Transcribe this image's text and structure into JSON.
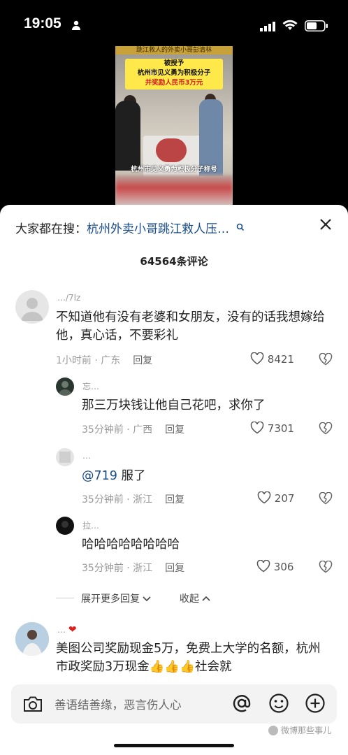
{
  "status_bar": {
    "time": "19:05"
  },
  "video": {
    "top_banner": "跳江救人的外卖小哥彭清林",
    "notice_line1": "被授予",
    "notice_line2": "杭州市见义勇为积极分子",
    "notice_line3": "并奖励人民币3万元",
    "caption": "杭州市见义勇为积极分子称号"
  },
  "search": {
    "prefix": "大家都在搜：",
    "query": "杭州外卖小哥跳江救人压…"
  },
  "comments_count": "64564",
  "comments_count_suffix": "条评论",
  "comments": [
    {
      "user": "…/7lz",
      "text": "不知道他有没有老婆和女朋友，没有的话我想嫁给他，真心话，不要彩礼",
      "time": "1小时前 · 广东",
      "reply": "回复",
      "likes": "8421"
    },
    {
      "user": "忘…",
      "text": "那三万块钱让他自己花吧，求你了",
      "time": "35分钟前 · 广西",
      "reply": "回复",
      "likes": "7301"
    },
    {
      "user": "…",
      "mention": "@719",
      "text": " 服了",
      "time": "35分钟前 · 浙江",
      "reply": "回复",
      "likes": "207"
    },
    {
      "user": "拉…",
      "text": "哈哈哈哈哈哈哈哈",
      "time": "35分钟前 · 浙江",
      "reply": "回复",
      "likes": "306"
    },
    {
      "user": "…",
      "text": "美图公司奖励现金5万，免费上大学的名额，杭州市政奖励3万现金👍👍👍社会就"
    }
  ],
  "expand_more": "展开更多回复",
  "collapse": "收起",
  "input": {
    "placeholder": "善语结善缘，恶言伤人心"
  },
  "watermark": "微博那些事儿",
  "colors": {
    "link": "#1a4d8c",
    "muted": "#999999"
  }
}
